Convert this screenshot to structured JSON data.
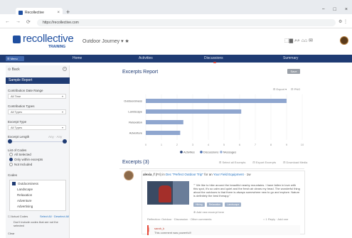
{
  "browser": {
    "tab_title": "Recollective",
    "tab_close": "×",
    "new_tab": "+",
    "window_controls": [
      "−",
      "□",
      "×"
    ],
    "nav_icons": [
      "←",
      "→",
      "⟳"
    ],
    "url": "https://recollective.com",
    "extension_icons": "⚙ ⋮"
  },
  "header": {
    "logo_text": "recollective",
    "logo_sub": "TRAINING",
    "project": "Outdoor Journey ▾ ★",
    "icons": "⬚▆  ⌕⌕  ⌂⌂  ✉"
  },
  "nav": {
    "dropdown": "☰ Menu",
    "items": [
      "Home",
      "Activities",
      "Discussions",
      "Summary"
    ]
  },
  "sidebar": {
    "top_label": "⊙ Back",
    "add": "+",
    "report_header": "Sample Report",
    "fields": [
      {
        "label": "Contribution Date Range",
        "value": "All Time"
      },
      {
        "label": "Contribution Types",
        "value": "All Types"
      },
      {
        "label": "Excerpt Type",
        "value": "All Types"
      }
    ],
    "length_label": "Excerpt Length",
    "length_hint": "Any · Any",
    "list_label": "List of Codes",
    "radios": [
      "All Selected",
      "Only within excerpts",
      "Not Included"
    ],
    "codes_label": "Codes",
    "codes": [
      "Outdoorsiness",
      "Landscape",
      "Relaxation",
      "Adventure",
      "Advertising"
    ],
    "foot_1": "☐ Actual Codes",
    "foot_1b": "Select All · Deselect All",
    "foot_2": "Don't include codes that are not the selected",
    "foot_3": "Clear"
  },
  "main": {
    "report_title": "Excerpts Report",
    "report_button": "Save",
    "chart_tools": [
      "⊟ Export ▾",
      "⊟ PNG"
    ],
    "excerpts_title": "Excerpts (3)",
    "excerpts_tools": [
      "⊟ Select all Excerpts",
      "⊟ Export Excerpts",
      "⊟ Download Media"
    ],
    "post": {
      "author": "alexia_f",
      "prefix": " (Fri) in ",
      "activity": "Dec \"Perfect Outdoor Trip\"",
      "mid": " for an ",
      "task": "Your Field Equipment",
      "suffix": " · 1w",
      "text": "\"\" We like to hike around the beautiful nearby mountains. I have fallen in love with this spot, it's so calm and quiet and the fresh air clears my head. The wonderful thing about the outdoors is that there is always somewhere new to go and explore. Nature is definitely the best therapy.\"",
      "tags": [
        "Hiking",
        "Relaxation",
        "Landscape"
      ],
      "meta": "⊕ Add new excerpt here",
      "foot_left": "Reflection: Outdoor · Discussion · Other comments",
      "foot_right": "○ 1 Reply · Add one",
      "comment_who": "sarah_k",
      "comment_text": "This comment was powerful!!"
    }
  },
  "chart_data": {
    "type": "bar",
    "orientation": "horizontal",
    "categories": [
      "Outdoorsiness",
      "Landscape",
      "Relaxation",
      "Adventure"
    ],
    "values": [
      9,
      6.1,
      2.4,
      2.2
    ],
    "xlim": [
      0,
      10
    ],
    "xticks": [
      "0",
      "1",
      "2",
      "3",
      "4",
      "5",
      "6",
      "7",
      "8",
      "9",
      "10"
    ],
    "grid": true,
    "legend": [
      "Activities",
      "Discussions",
      "Messages"
    ],
    "legend_position": "bottom",
    "colors": {
      "bar": "#8fa6cf",
      "legend": [
        "#1f3b73",
        "#4a6fb0",
        "#9ab0d6"
      ]
    }
  }
}
